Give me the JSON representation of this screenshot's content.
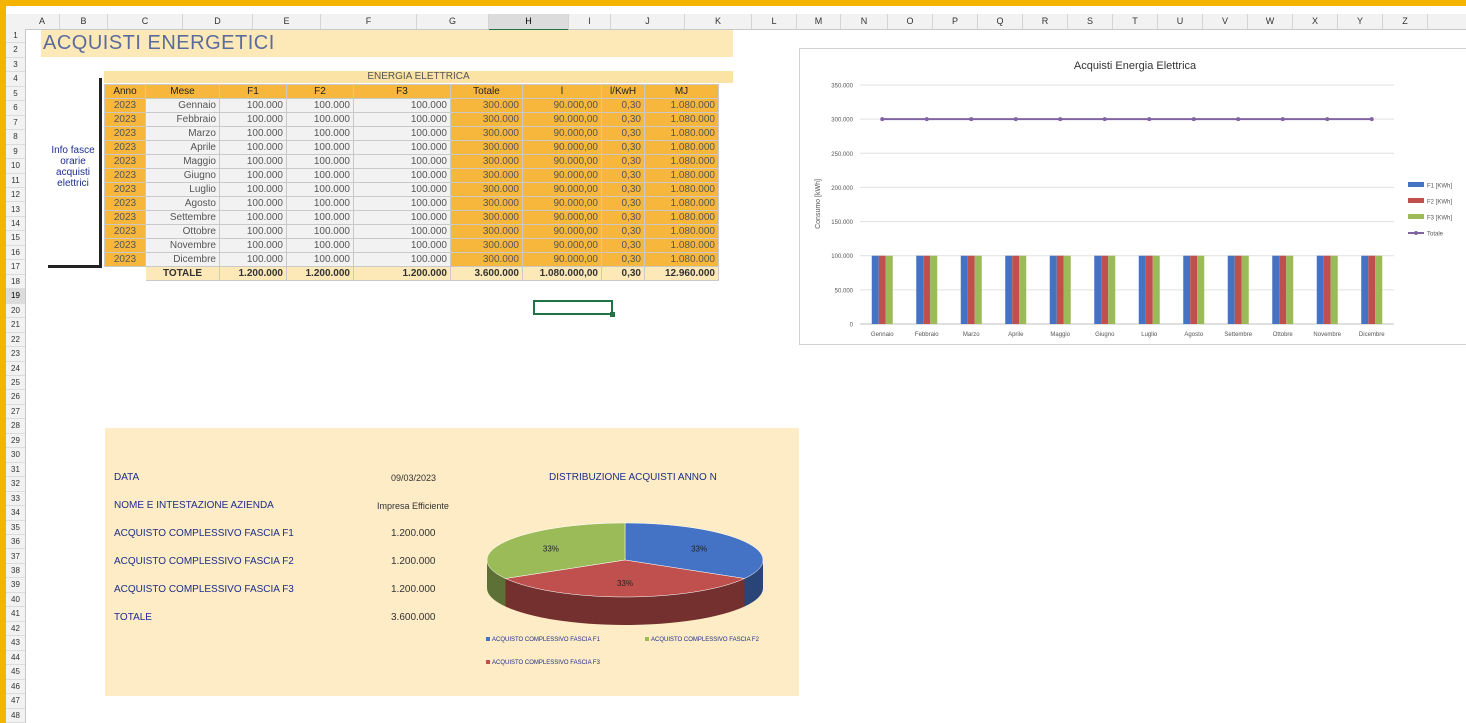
{
  "sheet": {
    "columns": [
      "A",
      "B",
      "C",
      "D",
      "E",
      "F",
      "G",
      "H",
      "I",
      "J",
      "K",
      "L",
      "M",
      "N",
      "O",
      "P",
      "Q",
      "R",
      "S",
      "T",
      "U",
      "V",
      "W",
      "X",
      "Y",
      "Z"
    ],
    "selected_column": "H",
    "rows_count": 48,
    "selected_row": 19
  },
  "title": "ACQUISTI ENERGETICI",
  "table": {
    "group_header": "ENERGIA ELETTRICA",
    "headers": [
      "Anno",
      "Mese",
      "F1",
      "F2",
      "F3",
      "Totale",
      "l",
      "l/KwH",
      "MJ"
    ],
    "rows": [
      [
        "2023",
        "Gennaio",
        "100.000",
        "100.000",
        "100.000",
        "300.000",
        "90.000,00",
        "0,30",
        "1.080.000"
      ],
      [
        "2023",
        "Febbraio",
        "100.000",
        "100.000",
        "100.000",
        "300.000",
        "90.000,00",
        "0,30",
        "1.080.000"
      ],
      [
        "2023",
        "Marzo",
        "100.000",
        "100.000",
        "100.000",
        "300.000",
        "90.000,00",
        "0,30",
        "1.080.000"
      ],
      [
        "2023",
        "Aprile",
        "100.000",
        "100.000",
        "100.000",
        "300.000",
        "90.000,00",
        "0,30",
        "1.080.000"
      ],
      [
        "2023",
        "Maggio",
        "100.000",
        "100.000",
        "100.000",
        "300.000",
        "90.000,00",
        "0,30",
        "1.080.000"
      ],
      [
        "2023",
        "Giugno",
        "100.000",
        "100.000",
        "100.000",
        "300.000",
        "90.000,00",
        "0,30",
        "1.080.000"
      ],
      [
        "2023",
        "Luglio",
        "100.000",
        "100.000",
        "100.000",
        "300.000",
        "90.000,00",
        "0,30",
        "1.080.000"
      ],
      [
        "2023",
        "Agosto",
        "100.000",
        "100.000",
        "100.000",
        "300.000",
        "90.000,00",
        "0,30",
        "1.080.000"
      ],
      [
        "2023",
        "Settembre",
        "100.000",
        "100.000",
        "100.000",
        "300.000",
        "90.000,00",
        "0,30",
        "1.080.000"
      ],
      [
        "2023",
        "Ottobre",
        "100.000",
        "100.000",
        "100.000",
        "300.000",
        "90.000,00",
        "0,30",
        "1.080.000"
      ],
      [
        "2023",
        "Novembre",
        "100.000",
        "100.000",
        "100.000",
        "300.000",
        "90.000,00",
        "0,30",
        "1.080.000"
      ],
      [
        "2023",
        "Dicembre",
        "100.000",
        "100.000",
        "100.000",
        "300.000",
        "90.000,00",
        "0,30",
        "1.080.000"
      ]
    ],
    "total_row": [
      "TOTALE",
      "1.200.000",
      "1.200.000",
      "1.200.000",
      "3.600.000",
      "1.080.000,00",
      "0,30",
      "12.960.000"
    ]
  },
  "info_label": "Info fasce orarie acquisti elettrici",
  "chart_data": [
    {
      "type": "bar",
      "title": "Acquisti Energia Elettrica",
      "ylabel": "Consumo [kWh]",
      "xlabel": "",
      "categories": [
        "Gennaio",
        "Febbraio",
        "Marzo",
        "Aprile",
        "Maggio",
        "Giugno",
        "Luglio",
        "Agosto",
        "Settembre",
        "Ottobre",
        "Novembre",
        "Dicembre"
      ],
      "ylim": [
        0,
        350000
      ],
      "yticks": [
        "0",
        "50.000",
        "100.000",
        "150.000",
        "200.000",
        "250.000",
        "300.000",
        "350.000"
      ],
      "series": [
        {
          "name": "F1 [KWh]",
          "kind": "bar",
          "color": "#4472c4",
          "values": [
            100000,
            100000,
            100000,
            100000,
            100000,
            100000,
            100000,
            100000,
            100000,
            100000,
            100000,
            100000
          ]
        },
        {
          "name": "F2 [KWh]",
          "kind": "bar",
          "color": "#c0504d",
          "values": [
            100000,
            100000,
            100000,
            100000,
            100000,
            100000,
            100000,
            100000,
            100000,
            100000,
            100000,
            100000
          ]
        },
        {
          "name": "F3 [KWh]",
          "kind": "bar",
          "color": "#9bbb59",
          "values": [
            100000,
            100000,
            100000,
            100000,
            100000,
            100000,
            100000,
            100000,
            100000,
            100000,
            100000,
            100000
          ]
        },
        {
          "name": "Totale",
          "kind": "line",
          "color": "#8064a2",
          "values": [
            300000,
            300000,
            300000,
            300000,
            300000,
            300000,
            300000,
            300000,
            300000,
            300000,
            300000,
            300000
          ]
        }
      ],
      "legend": "right",
      "grid": true
    },
    {
      "type": "pie",
      "title": "DISTRIBUZIONE ACQUISTI ANNO N",
      "categories": [
        "ACQUISTO COMPLESSIVO FASCIA F1",
        "ACQUISTO COMPLESSIVO FASCIA F2",
        "ACQUISTO COMPLESSIVO FASCIA F3"
      ],
      "values": [
        1200000,
        1200000,
        1200000
      ],
      "labels": [
        "33%",
        "33%",
        "33%"
      ],
      "colors": [
        "#4472c4",
        "#9bbb59",
        "#c0504d"
      ],
      "legend": "bottom"
    }
  ],
  "summary": {
    "data_label": "DATA",
    "data_value": "09/03/2023",
    "company_label": "NOME E INTESTAZIONE AZIENDA",
    "company_value": "Impresa Efficiente",
    "f1_label": "ACQUISTO COMPLESSIVO FASCIA F1",
    "f1_value": "1.200.000",
    "f2_label": "ACQUISTO COMPLESSIVO FASCIA F2",
    "f2_value": "1.200.000",
    "f3_label": "ACQUISTO COMPLESSIVO FASCIA F3",
    "f3_value": "1.200.000",
    "total_label": "TOTALE",
    "total_value": "3.600.000"
  }
}
